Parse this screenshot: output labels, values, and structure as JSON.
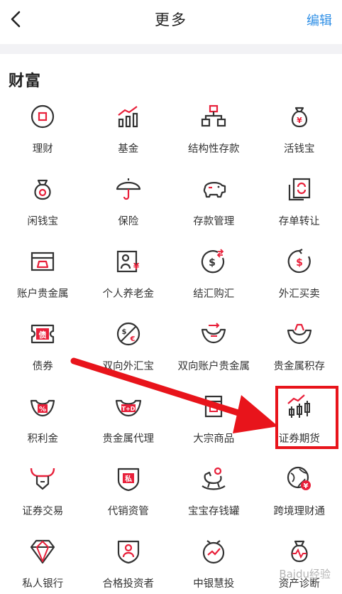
{
  "header": {
    "title": "更多",
    "edit_label": "编辑"
  },
  "section": {
    "title": "财富"
  },
  "items": [
    {
      "label": "理财",
      "icon": "wealth-coin-icon"
    },
    {
      "label": "基金",
      "icon": "fund-chart-icon"
    },
    {
      "label": "结构性存款",
      "icon": "structure-tree-icon"
    },
    {
      "label": "活钱宝",
      "icon": "yen-bag-icon"
    },
    {
      "label": "闲钱宝",
      "icon": "money-bag-icon"
    },
    {
      "label": "保险",
      "icon": "umbrella-icon"
    },
    {
      "label": "存款管理",
      "icon": "piggy-bank-icon"
    },
    {
      "label": "存单转让",
      "icon": "certificate-transfer-icon"
    },
    {
      "label": "账户贵金属",
      "icon": "gold-bar-box-icon"
    },
    {
      "label": "个人养老金",
      "icon": "pension-person-icon"
    },
    {
      "label": "结汇购汇",
      "icon": "dollar-exchange-icon"
    },
    {
      "label": "外汇买卖",
      "icon": "dollar-cycle-icon"
    },
    {
      "label": "债券",
      "icon": "bond-ticket-icon"
    },
    {
      "label": "双向外汇宝",
      "icon": "dollar-euro-icon"
    },
    {
      "label": "双向账户贵金属",
      "icon": "ingot-arrows-icon"
    },
    {
      "label": "贵金属积存",
      "icon": "ingot-icon"
    },
    {
      "label": "积利金",
      "icon": "ingot-percent-icon"
    },
    {
      "label": "贵金属代理",
      "icon": "ingot-td-icon"
    },
    {
      "label": "大宗商品",
      "icon": "commodity-box-icon"
    },
    {
      "label": "证券期货",
      "icon": "candlestick-icon"
    },
    {
      "label": "证券交易",
      "icon": "bull-icon"
    },
    {
      "label": "代销资管",
      "icon": "shield-private-icon"
    },
    {
      "label": "宝宝存钱罐",
      "icon": "rocking-horse-icon"
    },
    {
      "label": "跨境理财通",
      "icon": "globe-yen-icon"
    },
    {
      "label": "私人银行",
      "icon": "diamond-icon"
    },
    {
      "label": "合格投资者",
      "icon": "shield-person-icon"
    },
    {
      "label": "中银慧投",
      "icon": "clock-chart-icon"
    },
    {
      "label": "资产诊断",
      "icon": "diagnosis-bag-icon"
    }
  ],
  "colors": {
    "icon_dark": "#333333",
    "icon_accent": "#e8203a",
    "link": "#2f8fe6",
    "annotation": "#e8141b"
  },
  "watermark": "Baidu经验"
}
